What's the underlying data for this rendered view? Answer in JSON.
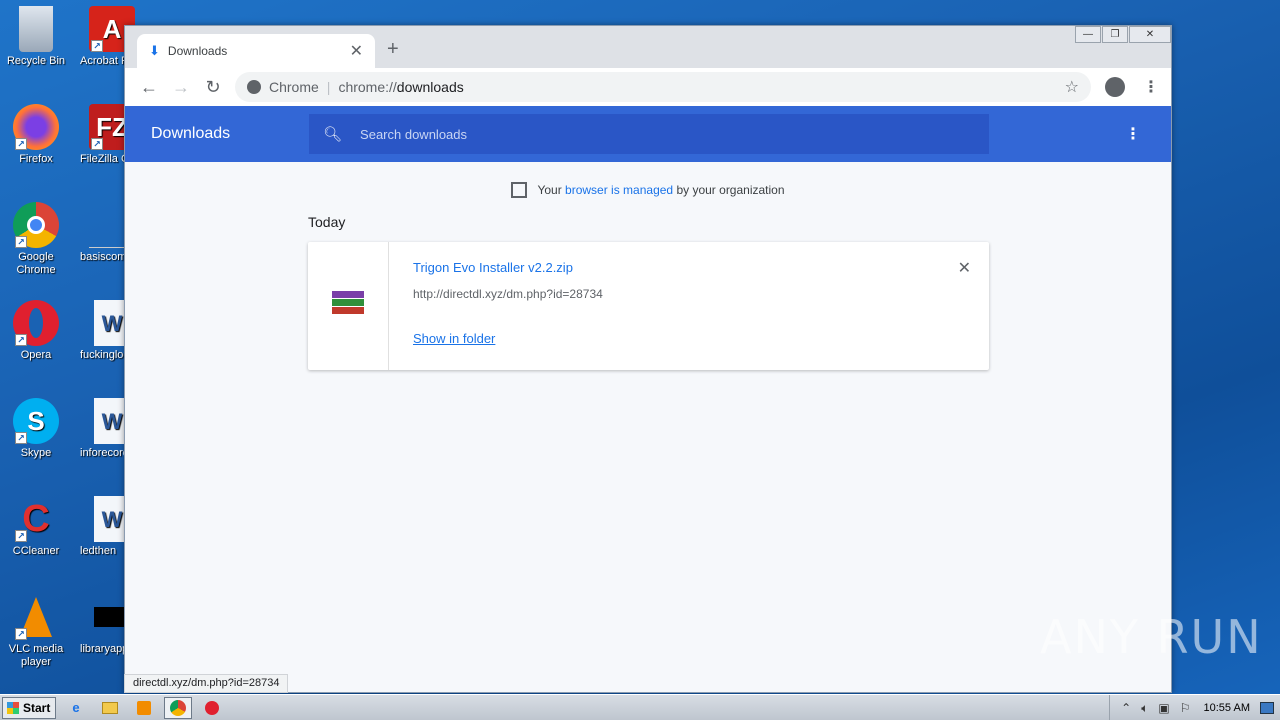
{
  "desktop": {
    "column1": [
      {
        "label": "Recycle Bin",
        "icon": "recycle-bin-icon"
      },
      {
        "label": "Firefox",
        "icon": "firefox-icon"
      },
      {
        "label": "Google Chrome",
        "icon": "chrome-icon"
      },
      {
        "label": "Opera",
        "icon": "opera-icon"
      },
      {
        "label": "Skype",
        "icon": "skype-icon"
      },
      {
        "label": "CCleaner",
        "icon": "ccleaner-icon"
      },
      {
        "label": "VLC media player",
        "icon": "vlc-icon"
      }
    ],
    "column2": [
      {
        "label": "Acrobat Reader",
        "icon": "acrobat-icon"
      },
      {
        "label": "FileZilla Client",
        "icon": "filezilla-icon"
      },
      {
        "label": "basiscomm",
        "icon": "document-icon"
      },
      {
        "label": "fuckinglock",
        "icon": "word-doc-icon"
      },
      {
        "label": "inforecord",
        "icon": "word-doc-icon"
      },
      {
        "label": "ledthen",
        "icon": "word-doc-icon"
      },
      {
        "label": "libraryapp",
        "icon": "app-icon"
      }
    ]
  },
  "browser": {
    "tab_title": "Downloads",
    "omnibox_site": "Chrome",
    "omnibox_url_scheme": "chrome://",
    "omnibox_url_path": "downloads",
    "window_controls": [
      "minimize",
      "restore",
      "close"
    ]
  },
  "downloads": {
    "header_title": "Downloads",
    "search_placeholder": "Search downloads",
    "managed_prefix": "Your ",
    "managed_link": "browser is managed",
    "managed_suffix": " by your organization",
    "section_label": "Today",
    "item": {
      "file_name": "Trigon Evo Installer v2.2.zip",
      "source_url": "http://directdl.xyz/dm.php?id=28734",
      "action_label": "Show in folder"
    }
  },
  "status_tooltip": "directdl.xyz/dm.php?id=28734",
  "watermark": "ANY RUN",
  "taskbar": {
    "start_label": "Start",
    "clock": "10:55 AM"
  }
}
